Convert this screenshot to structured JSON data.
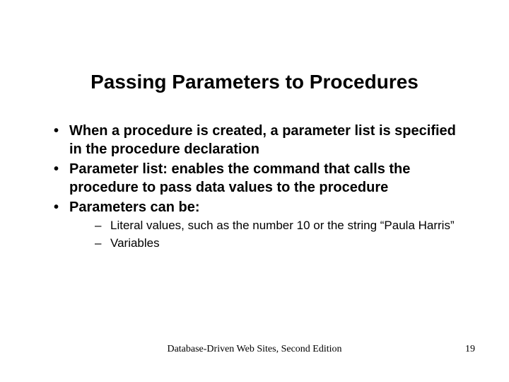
{
  "title": "Passing Parameters to Procedures",
  "bullets": [
    {
      "text": "When a procedure is created, a parameter list is specified in the procedure declaration"
    },
    {
      "text": "Parameter list: enables the command that calls the procedure to pass data values to the procedure"
    },
    {
      "text": "Parameters can be:",
      "sub": [
        "Literal values, such as the number 10 or the string “Paula Harris”",
        "Variables"
      ]
    }
  ],
  "footer": "Database-Driven Web Sites, Second Edition",
  "page": "19"
}
